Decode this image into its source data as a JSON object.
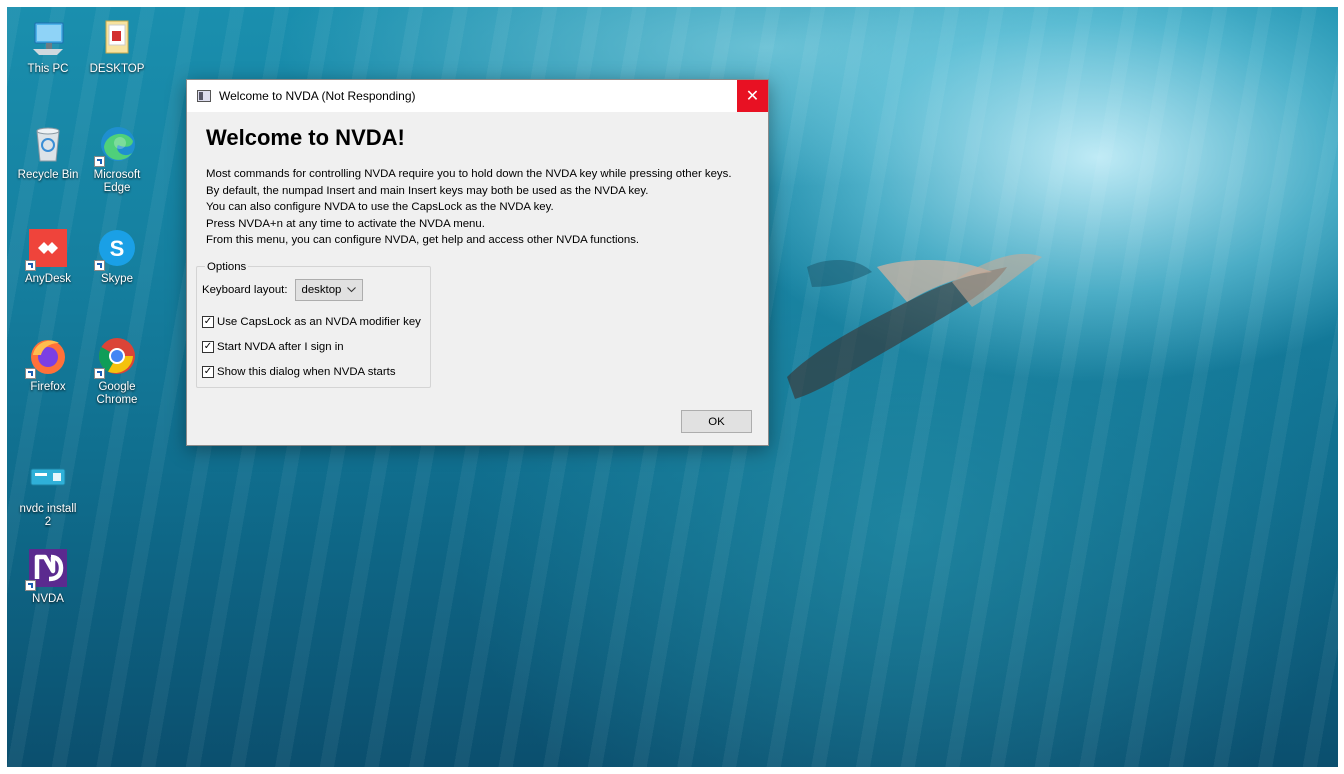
{
  "desktop": {
    "icons": [
      {
        "label": "This PC",
        "icon": "computer-icon"
      },
      {
        "label": "DESKTOP",
        "icon": "folder-icon"
      },
      {
        "label": "Recycle Bin",
        "icon": "recycle-bin-icon"
      },
      {
        "label": "Microsoft Edge",
        "icon": "edge-icon"
      },
      {
        "label": "AnyDesk",
        "icon": "anydesk-icon"
      },
      {
        "label": "Skype",
        "icon": "skype-icon"
      },
      {
        "label": "Firefox",
        "icon": "firefox-icon"
      },
      {
        "label": "Google Chrome",
        "icon": "chrome-icon"
      },
      {
        "label": "nvdc install 2",
        "icon": "installer-icon"
      },
      {
        "label": "NVDA",
        "icon": "nvda-icon"
      }
    ]
  },
  "dialog": {
    "title": "Welcome to NVDA (Not Responding)",
    "close_glyph": "✕",
    "heading": "Welcome to NVDA!",
    "paragraphs": [
      "Most commands for controlling NVDA require you to hold down the NVDA key while pressing other keys.",
      "By default, the numpad Insert and main Insert keys may both be used as the NVDA key.",
      "You can also configure NVDA to use the CapsLock as the NVDA key.",
      "Press NVDA+n at any time to activate the NVDA menu.",
      "From this menu, you can configure NVDA, get help and access other NVDA functions."
    ],
    "options": {
      "legend": "Options",
      "keyboard_layout_label": "Keyboard layout:",
      "keyboard_layout_value": "desktop",
      "checkboxes": [
        {
          "label": "Use CapsLock as an NVDA modifier key",
          "checked": true
        },
        {
          "label": "Start NVDA after I sign in",
          "checked": true
        },
        {
          "label": "Show this dialog when NVDA starts",
          "checked": true
        }
      ]
    },
    "ok_label": "OK"
  },
  "colors": {
    "close_button": "#e81123",
    "dialog_background": "#f0f0f0",
    "desktop_water": "#157f9f"
  }
}
